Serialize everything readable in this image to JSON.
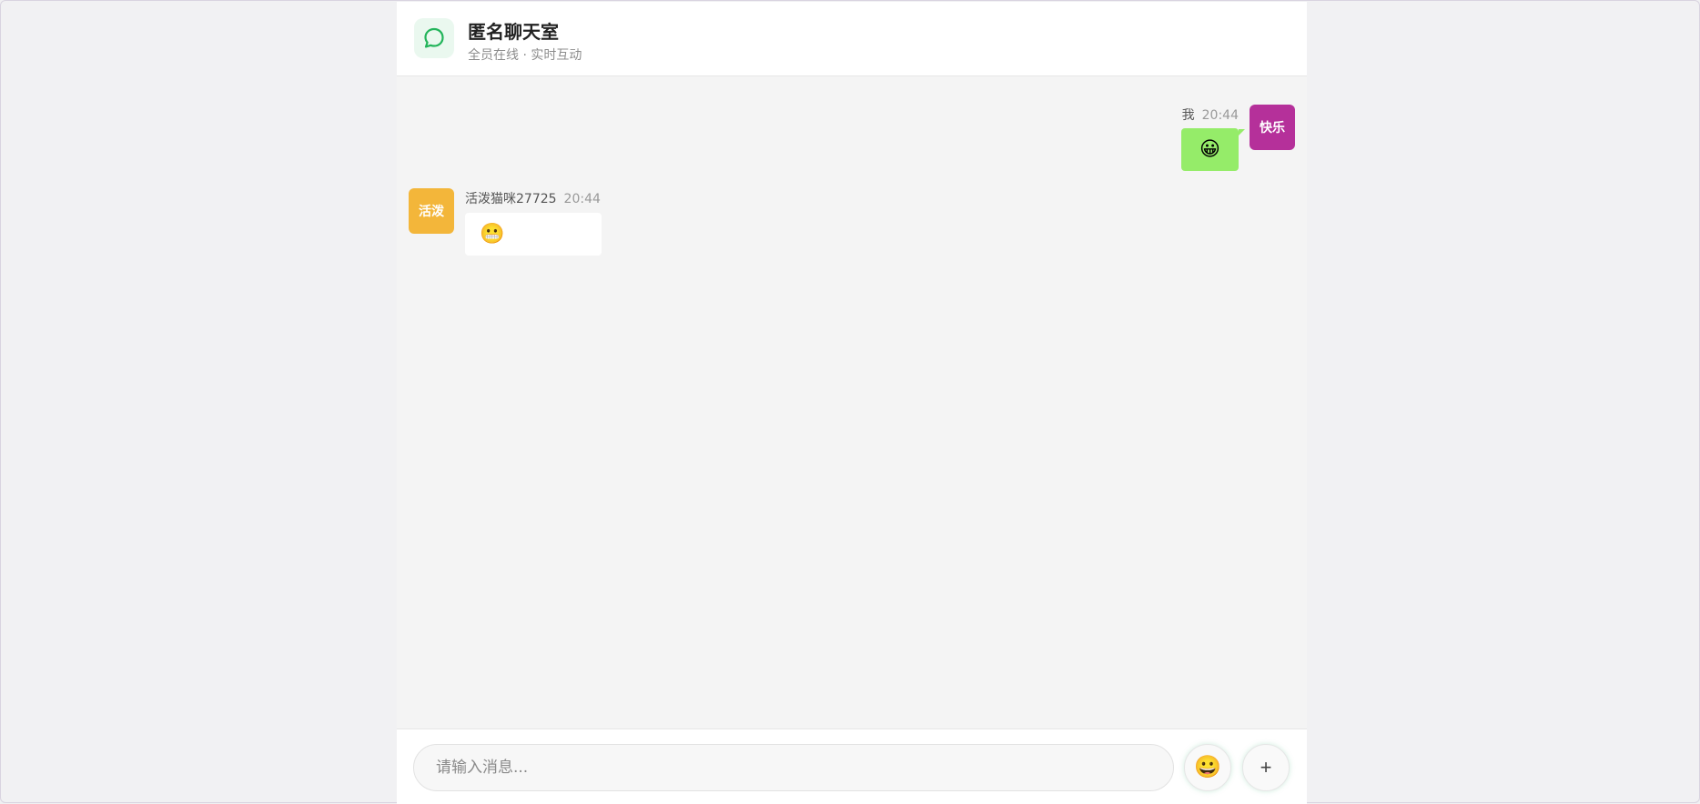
{
  "header": {
    "title": "匿名聊天室",
    "subtitle": "全员在线 · 实时互动",
    "logo_icon": "chat-bubble-icon",
    "accent": "#22b45a"
  },
  "messages": [
    {
      "side": "right",
      "sender": "我",
      "time": "20:44",
      "avatar_text": "快乐",
      "avatar_color": "#b5309a",
      "bubble_color": "#95ec69",
      "content": "😀"
    },
    {
      "side": "left",
      "sender": "活泼猫咪27725",
      "time": "20:44",
      "avatar_text": "活泼",
      "avatar_color": "#f3b63a",
      "bubble_color": "#ffffff",
      "content": "😬"
    }
  ],
  "input": {
    "placeholder": "请输入消息...",
    "value": ""
  },
  "buttons": {
    "emoji_label": "😀",
    "plus_label": "+"
  }
}
